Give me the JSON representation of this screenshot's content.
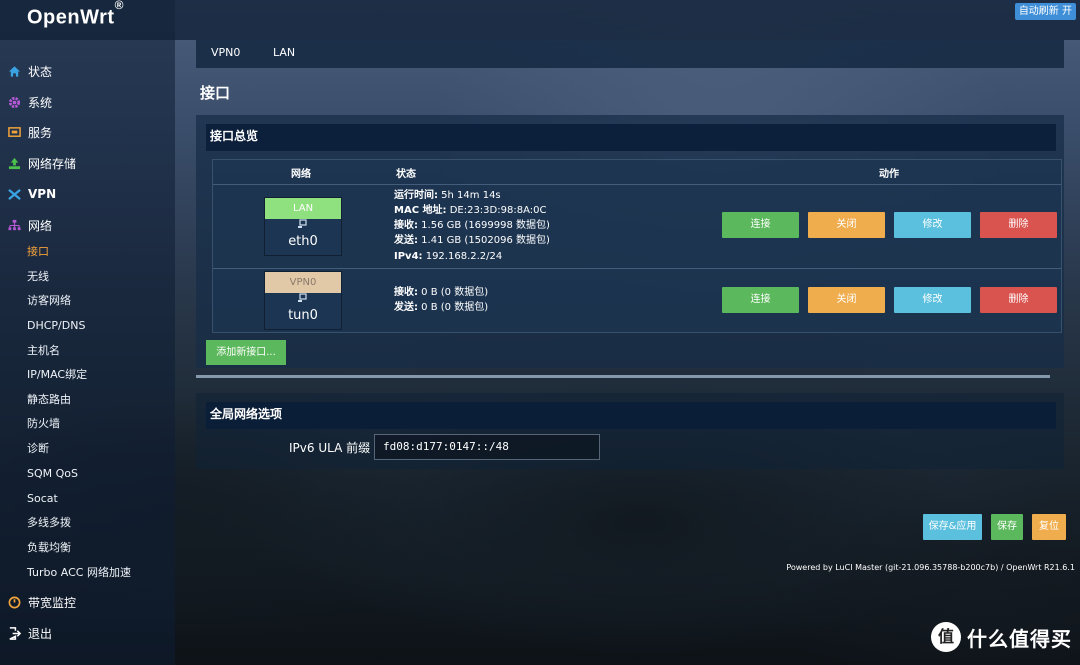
{
  "app": {
    "title": "OpenWrt",
    "title_mark": "®"
  },
  "topbar": {
    "refresh_label": "自动刷新 开"
  },
  "sidebar": {
    "items": [
      {
        "label": "状态",
        "icon": "home-icon",
        "color": "#3aa3e3"
      },
      {
        "label": "系统",
        "icon": "gear-icon",
        "color": "#b45ad6"
      },
      {
        "label": "服务",
        "icon": "services-icon",
        "color": "#f0a33a"
      },
      {
        "label": "网络存储",
        "icon": "storage-icon",
        "color": "#4cc04c"
      },
      {
        "label": "VPN",
        "icon": "vpn-icon",
        "color": "#3aa3e3"
      },
      {
        "label": "网络",
        "icon": "network-icon",
        "color": "#b45ad6"
      }
    ],
    "network_sub": [
      "接口",
      "无线",
      "访客网络",
      "DHCP/DNS",
      "主机名",
      "IP/MAC绑定",
      "静态路由",
      "防火墙",
      "诊断",
      "SQM QoS",
      "Socat",
      "多线多拨",
      "负载均衡",
      "Turbo ACC 网络加速"
    ],
    "bottom_items": [
      {
        "label": "带宽监控",
        "icon": "monitor-icon",
        "color": "#f0a33a"
      },
      {
        "label": "退出",
        "icon": "logout-icon",
        "color": "#ffffff"
      }
    ]
  },
  "tabs": [
    "VPN0",
    "LAN"
  ],
  "page": {
    "title": "接口"
  },
  "overview": {
    "title": "接口总览",
    "headers": {
      "network": "网络",
      "status": "状态",
      "actions": "动作"
    },
    "rows": [
      {
        "name": "LAN",
        "device": "eth0",
        "color": "#8fe07e",
        "status": [
          {
            "key": "运行时间:",
            "value": " 5h 14m 14s"
          },
          {
            "key": "MAC 地址:",
            "value": " DE:23:3D:98:8A:0C"
          },
          {
            "key": "接收:",
            "value": " 1.56 GB (1699998 数据包)"
          },
          {
            "key": "发送:",
            "value": " 1.41 GB (1502096 数据包)"
          },
          {
            "key": "IPv4:",
            "value": " 192.168.2.2/24"
          }
        ]
      },
      {
        "name": "VPN0",
        "device": "tun0",
        "color": "#e1c9a8",
        "status": [
          {
            "key": "接收:",
            "value": " 0 B (0 数据包)"
          },
          {
            "key": "发送:",
            "value": " 0 B (0 数据包)"
          }
        ]
      }
    ],
    "actions": {
      "connect": "连接",
      "close": "关闭",
      "edit": "修改",
      "delete": "删除"
    },
    "add_label": "添加新接口..."
  },
  "global": {
    "title": "全局网络选项",
    "ula_label": "IPv6 ULA 前缀",
    "ula_value": "fd08:d177:0147::/48"
  },
  "footer": {
    "save_apply": "保存&应用",
    "save": "保存",
    "reset": "复位",
    "powered": "Powered by LuCI Master (git-21.096.35788-b200c7b) / OpenWrt R21.6.1"
  },
  "watermark": {
    "mark": "值",
    "text": "什么值得买"
  }
}
